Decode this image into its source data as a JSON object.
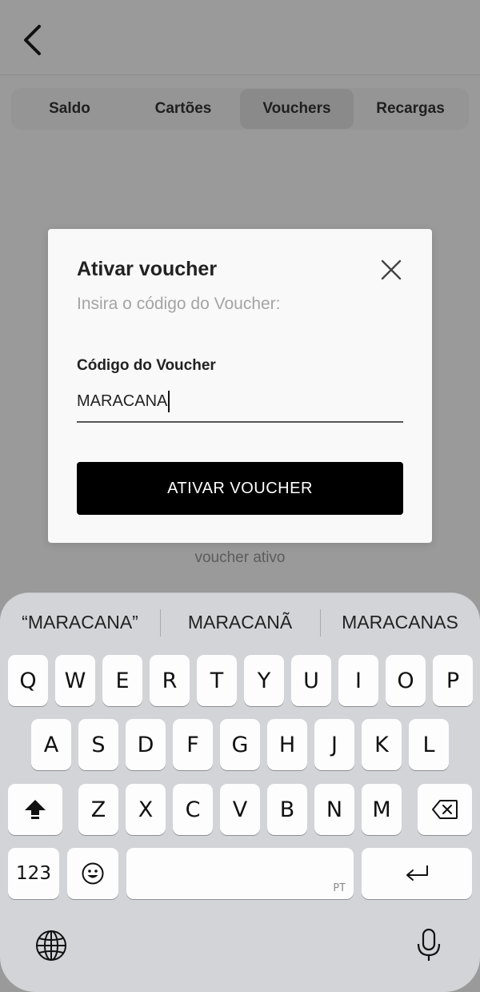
{
  "tabs": [
    {
      "label": "Saldo",
      "active": false
    },
    {
      "label": "Cartões",
      "active": false
    },
    {
      "label": "Vouchers",
      "active": true
    },
    {
      "label": "Recargas",
      "active": false
    }
  ],
  "background": {
    "partial_text": "voucher ativo"
  },
  "modal": {
    "title": "Ativar voucher",
    "subtitle": "Insira o código do Voucher:",
    "field_label": "Código do Voucher",
    "field_value": "MARACANA",
    "submit_label": "ATIVAR VOUCHER"
  },
  "keyboard": {
    "suggestions": [
      "“MARACANA”",
      "MARACANÃ",
      "MARACANAS"
    ],
    "row1": [
      "Q",
      "W",
      "E",
      "R",
      "T",
      "Y",
      "U",
      "I",
      "O",
      "P"
    ],
    "row2": [
      "A",
      "S",
      "D",
      "F",
      "G",
      "H",
      "J",
      "K",
      "L"
    ],
    "row3": [
      "Z",
      "X",
      "C",
      "V",
      "B",
      "N",
      "M"
    ],
    "numbers_label": "123",
    "space_language": "PT"
  }
}
